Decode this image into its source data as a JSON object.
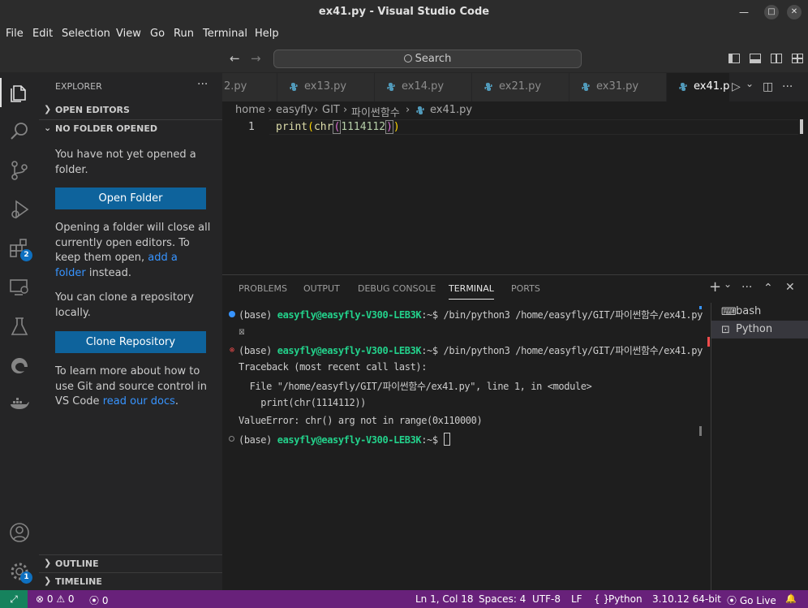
{
  "window": {
    "title": "ex41.py - Visual Studio Code",
    "minimize_glyph": "—",
    "maximize_glyph": "□",
    "close_glyph": "✕"
  },
  "menu": [
    "File",
    "Edit",
    "Selection",
    "View",
    "Go",
    "Run",
    "Terminal",
    "Help"
  ],
  "command_center": {
    "back_glyph": "←",
    "forward_glyph": "→",
    "search_label": "Search"
  },
  "activity_bar": {
    "extensions_badge": "2",
    "manage_badge": "1"
  },
  "sidebar": {
    "title": "EXPLORER",
    "more_glyph": "···",
    "open_editors": "OPEN EDITORS",
    "no_folder": "NO FOLDER OPENED",
    "msg_not_opened": "You have not yet opened a folder.",
    "open_folder_button": "Open Folder",
    "msg_opening_1": "Opening a folder will close all currently open editors. To keep them open,",
    "msg_opening_link": "add a folder",
    "msg_opening_2": "instead.",
    "msg_clone": "You can clone a repository locally.",
    "clone_button": "Clone Repository",
    "msg_learn": "To learn more about how to use Git and source control in VS Code",
    "msg_learn_link": "read our docs",
    "msg_learn_end": ".",
    "outline": "OUTLINE",
    "timeline": "TIMELINE",
    "chevron_right": "❯",
    "chevron_down": "⌄"
  },
  "tabs": [
    {
      "label": "2.py",
      "active": false
    },
    {
      "label": "ex13.py",
      "active": false
    },
    {
      "label": "ex14.py",
      "active": false
    },
    {
      "label": "ex21.py",
      "active": false
    },
    {
      "label": "ex31.py",
      "active": false
    },
    {
      "label": "ex41.p",
      "active": true
    }
  ],
  "tab_actions": {
    "run_glyph": "▷",
    "dropdown_glyph": "⌄",
    "split_glyph": "◫",
    "more_glyph": "···"
  },
  "breadcrumb": {
    "parts": [
      "home",
      "easyfly",
      "GIT",
      "파이썬함수",
      "ex41.py"
    ],
    "separator": "›"
  },
  "editor": {
    "line_number": "1",
    "code_fn": "print",
    "code_open1": "(",
    "code_fn2": "chr",
    "code_open2": "(",
    "code_num": "1114112",
    "code_close2": ")",
    "code_close1": ")"
  },
  "panel": {
    "tabs": [
      "PROBLEMS",
      "OUTPUT",
      "DEBUG CONSOLE",
      "TERMINAL",
      "PORTS"
    ],
    "active_tab": "TERMINAL",
    "add_glyph": "+",
    "dropdown_glyph": "⌄",
    "more_glyph": "···",
    "maximize_glyph": "⌃",
    "close_glyph": "✕"
  },
  "terminal": {
    "lines": [
      {
        "prefix": "(base) ",
        "user": "easyfly@easyfly-V300-LEB3K",
        "rest": ":~$ /bin/python3 /home/easyfly/GIT/파이썬함수/ex41.py"
      },
      {
        "text": "☒"
      },
      {
        "prefix": "(base) ",
        "user": "easyfly@easyfly-V300-LEB3K",
        "rest": ":~$ /bin/python3 /home/easyfly/GIT/파이썬함수/ex41.py"
      },
      {
        "text": "Traceback (most recent call last):"
      },
      {
        "text": "  File \"/home/easyfly/GIT/파이썬함수/ex41.py\", line 1, in <module>"
      },
      {
        "text": "    print(chr(1114112))"
      },
      {
        "text": "ValueError: chr() arg not in range(0x110000)"
      },
      {
        "prefix": "(base) ",
        "user": "easyfly@easyfly-V300-LEB3K",
        "rest": ":~$ "
      }
    ],
    "error_marker": "⊗"
  },
  "terminal_list": [
    {
      "icon": "⌨",
      "label": "bash",
      "selected": false
    },
    {
      "icon": "⊡",
      "label": "Python",
      "selected": true
    }
  ],
  "statusbar": {
    "remote_glyph": "⤢",
    "errors": "0",
    "warnings": "0",
    "ports": "0",
    "position": "Ln 1, Col 18",
    "spaces": "Spaces: 4",
    "encoding": "UTF-8",
    "eol": "LF",
    "language_glyph": "{ }",
    "language": "Python",
    "interpreter": "3.10.12 64-bit",
    "golive": "Go Live",
    "bell_glyph": "🔔"
  },
  "colors": {
    "statusbar": "#68217a",
    "remote": "#16825d",
    "button": "#0e639c",
    "link": "#3794ff",
    "prompt_user": "#23d18b",
    "badge": "#0e70c0"
  }
}
